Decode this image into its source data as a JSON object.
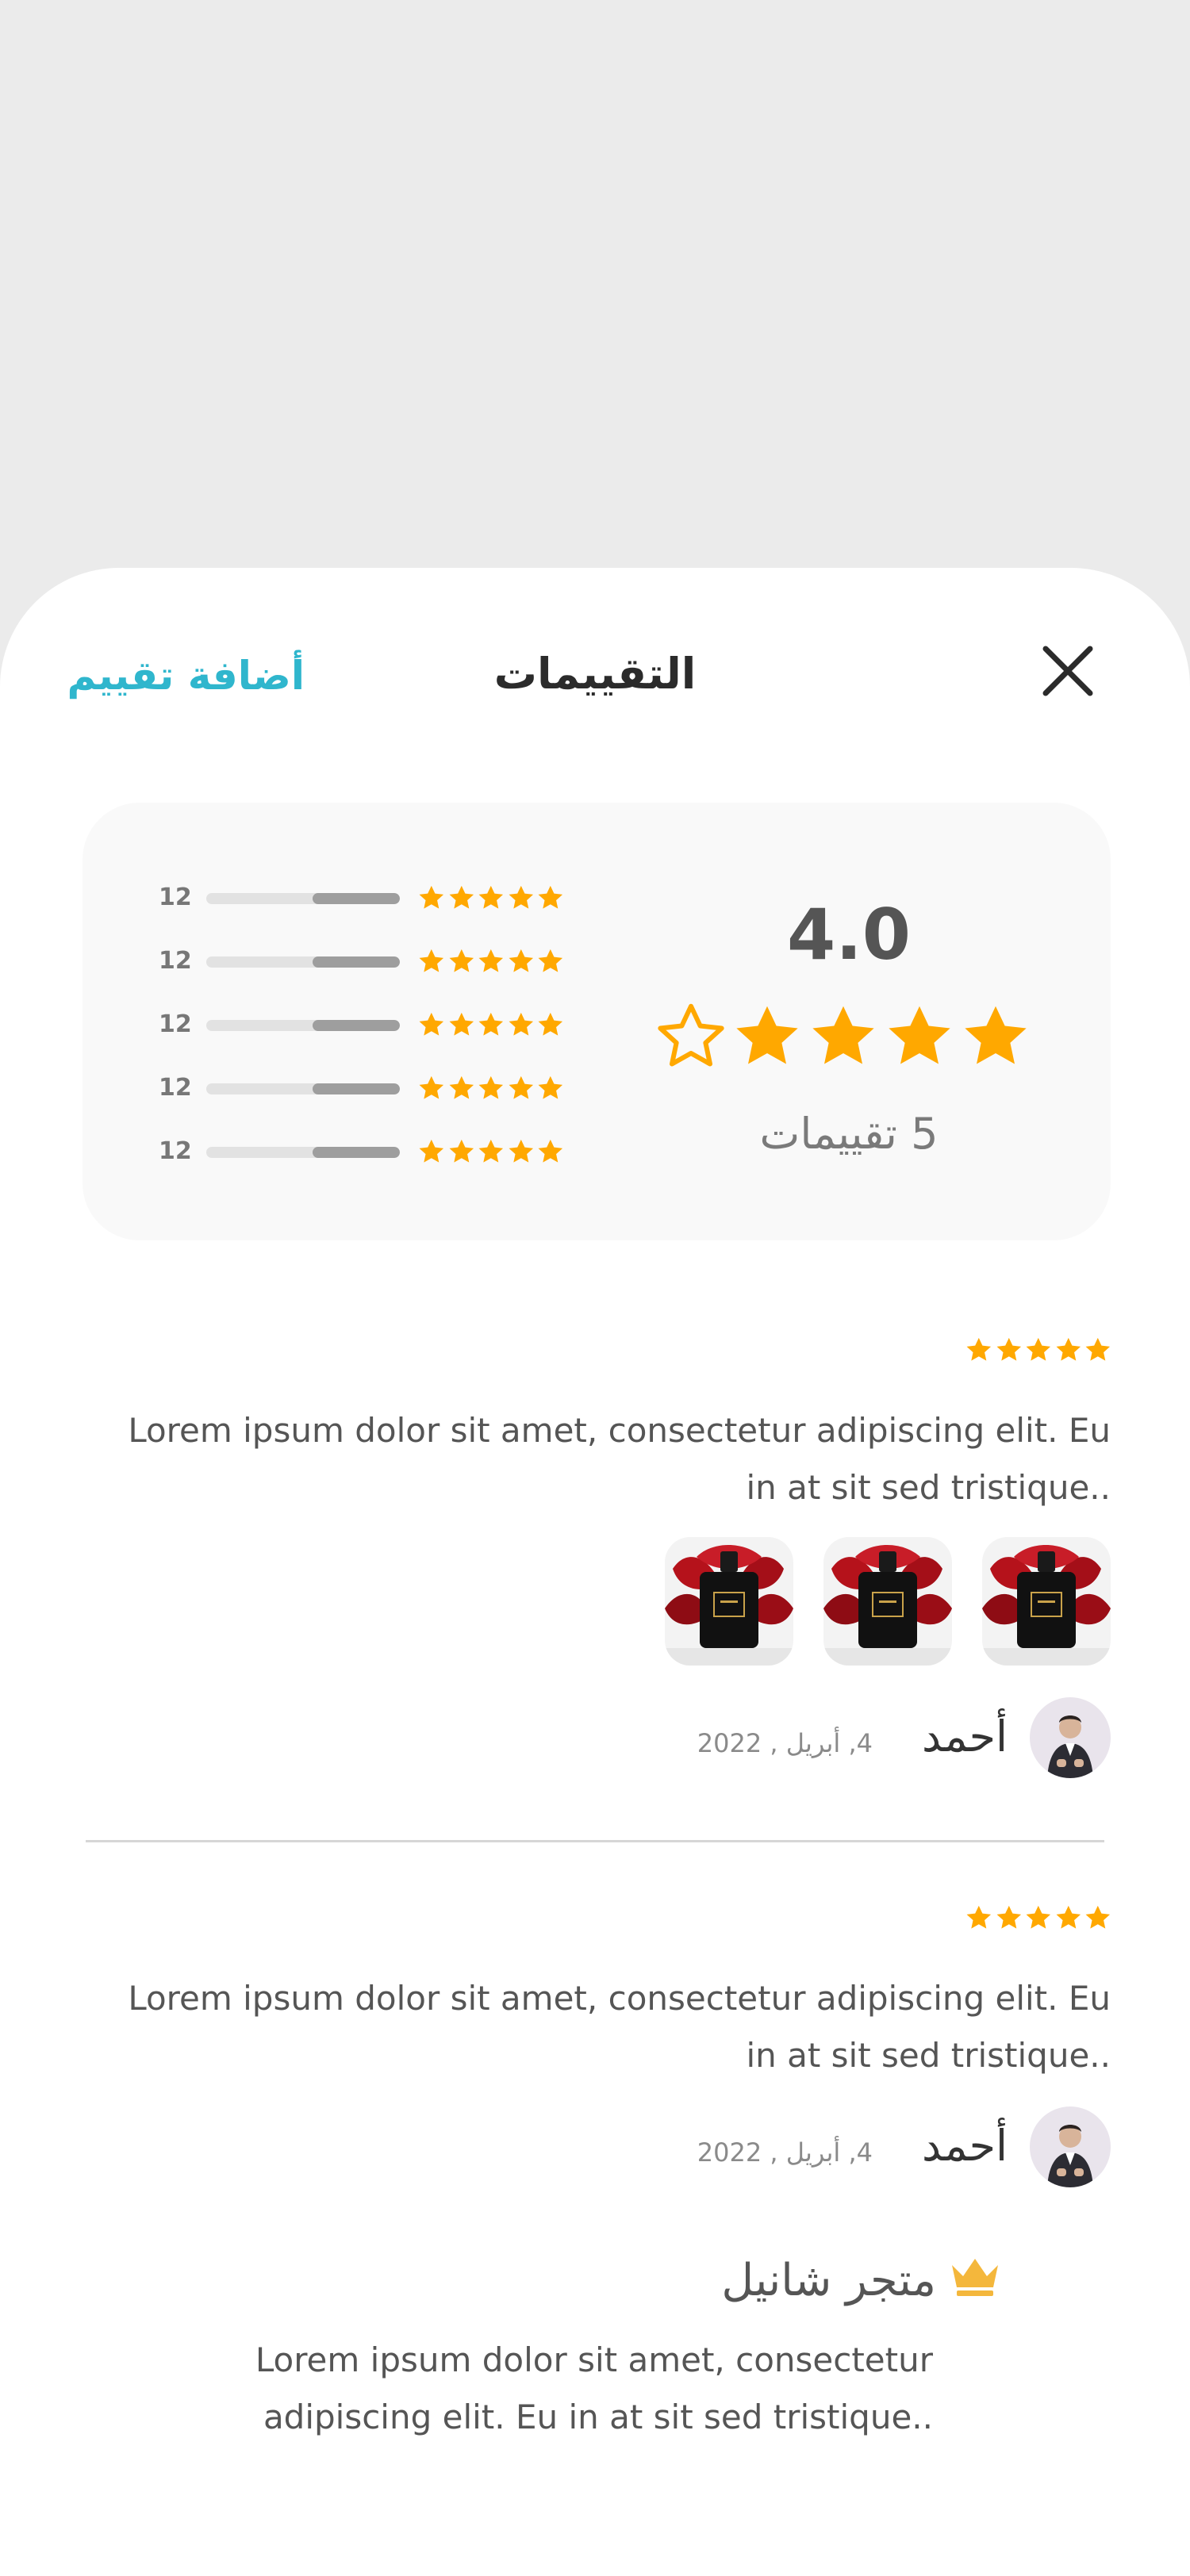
{
  "header": {
    "title": "التقييمات",
    "add_rating_label": "أضافة تقييم"
  },
  "summary": {
    "average": "4.0",
    "average_rating": 4,
    "rating_count_label": "5 تقييمات",
    "distribution": [
      {
        "count": "12",
        "stars": 5,
        "fill": 0.45
      },
      {
        "count": "12",
        "stars": 5,
        "fill": 0.45
      },
      {
        "count": "12",
        "stars": 5,
        "fill": 0.45
      },
      {
        "count": "12",
        "stars": 5,
        "fill": 0.45
      },
      {
        "count": "12",
        "stars": 5,
        "fill": 0.45
      }
    ]
  },
  "reviews": [
    {
      "stars": 5,
      "text": "Lorem ipsum dolor sit amet, consectetur adipiscing elit. Eu in at sit sed tristique..",
      "photos": [
        "perfume-bottle",
        "perfume-bottle",
        "perfume-bottle"
      ],
      "name": "أحمد",
      "date": "4, أبريل , 2022"
    },
    {
      "stars": 5,
      "text": "Lorem ipsum dolor sit amet, consectetur adipiscing elit. Eu in at sit sed tristique..",
      "name": "أحمد",
      "date": "4, أبريل , 2022",
      "store_reply": {
        "store_name": "متجر شانيل",
        "text": "Lorem ipsum dolor sit amet, consectetur adipiscing elit. Eu in at sit sed tristique.."
      }
    }
  ],
  "colors": {
    "accent": "#2fb6cd",
    "star": "#ffa800",
    "crown": "#f4b73c"
  }
}
